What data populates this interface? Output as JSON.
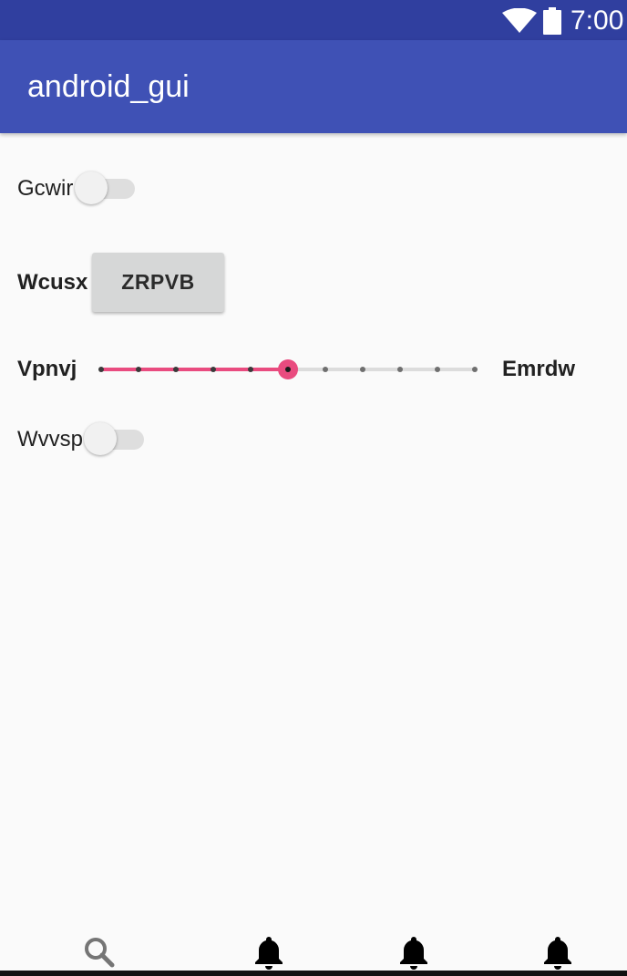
{
  "status_bar": {
    "time": "7:00",
    "wifi_icon": "wifi-icon",
    "battery_icon": "battery-icon"
  },
  "app_bar": {
    "title": "android_gui"
  },
  "controls": {
    "switch_1": {
      "label": "Gcwir",
      "checked": false
    },
    "button_row": {
      "label": "Wcusx",
      "button_text": "ZRPVB"
    },
    "slider": {
      "label_left": "Vpnvj",
      "label_right": "Emrdw",
      "steps": 10,
      "value": 5,
      "accent_color": "#e94b7f"
    },
    "switch_2": {
      "label": "Wvvsp",
      "checked": false
    }
  },
  "bottom_nav": {
    "items": [
      {
        "icon": "search-icon"
      },
      {
        "icon": "bell-icon"
      },
      {
        "icon": "bell-icon"
      },
      {
        "icon": "bell-icon"
      }
    ]
  },
  "colors": {
    "status_bar": "#303f9f",
    "app_bar": "#3f51b5",
    "accent": "#e94b7f",
    "background": "#fafafa"
  }
}
